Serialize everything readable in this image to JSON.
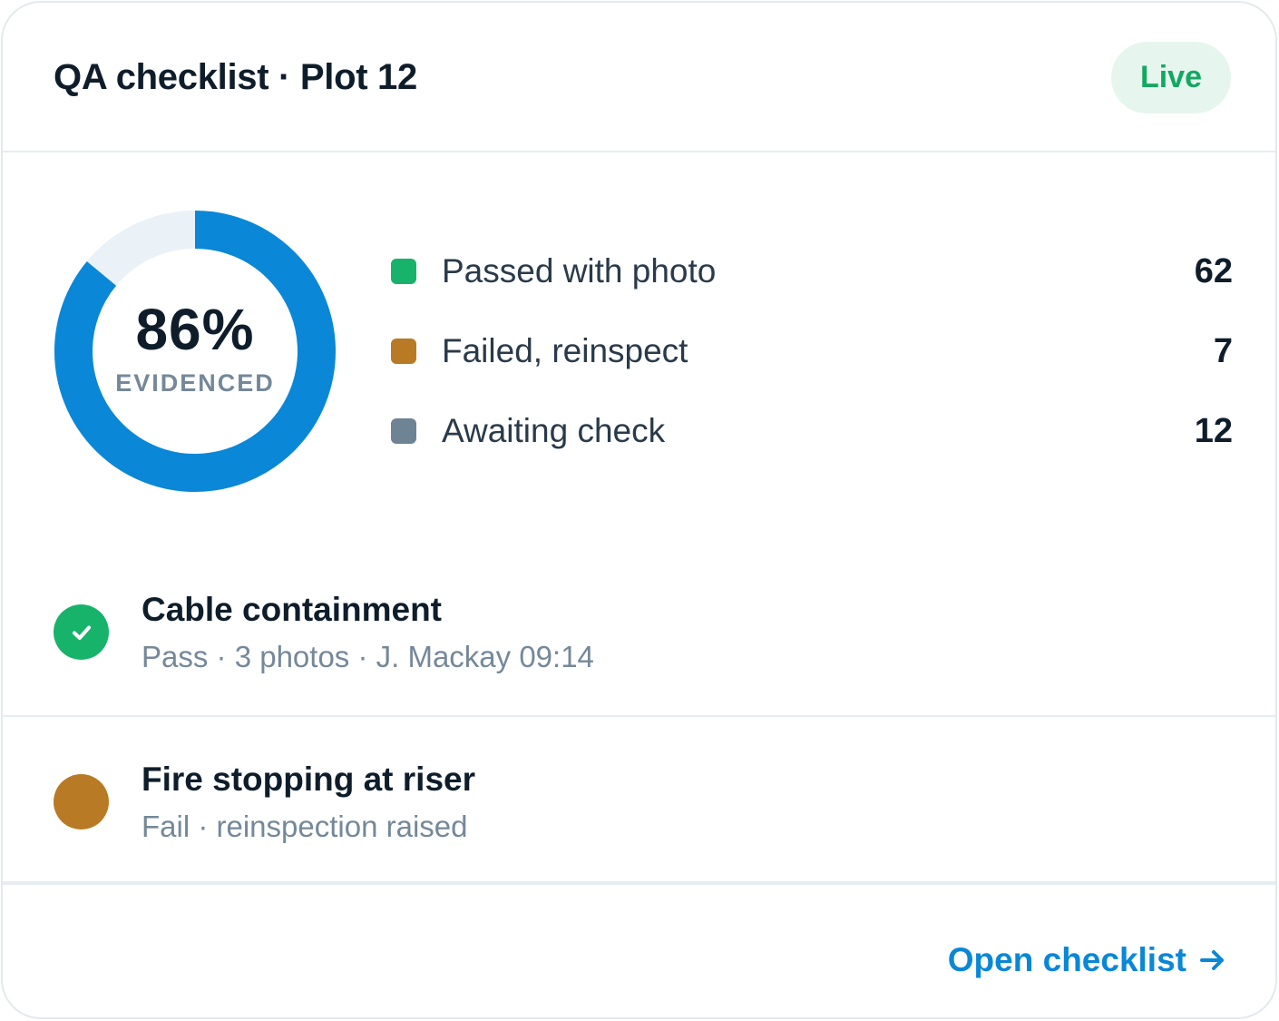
{
  "header": {
    "title": "QA checklist · Plot 12",
    "badge": "Live"
  },
  "summary": {
    "percent_text": "86%",
    "percent_value": 0.86,
    "percent_caption": "EVIDENCED",
    "colors": {
      "fill": "#0a87d6",
      "track": "#eaf2f8"
    }
  },
  "legend": [
    {
      "label": "Passed with photo",
      "count": "62",
      "color": "#17b36b"
    },
    {
      "label": "Failed, reinspect",
      "count": "7",
      "color": "#b87a25"
    },
    {
      "label": "Awaiting check",
      "count": "12",
      "color": "#6e8394"
    }
  ],
  "items": [
    {
      "title": "Cable containment",
      "meta": "Pass · 3 photos · J. Mackay 09:14",
      "status": "pass",
      "icon": "check-icon"
    },
    {
      "title": "Fire stopping at riser",
      "meta": "Fail · reinspection raised",
      "status": "fail"
    }
  ],
  "footer": {
    "link_label": "Open checklist",
    "link_icon": "arrow-right-icon"
  }
}
